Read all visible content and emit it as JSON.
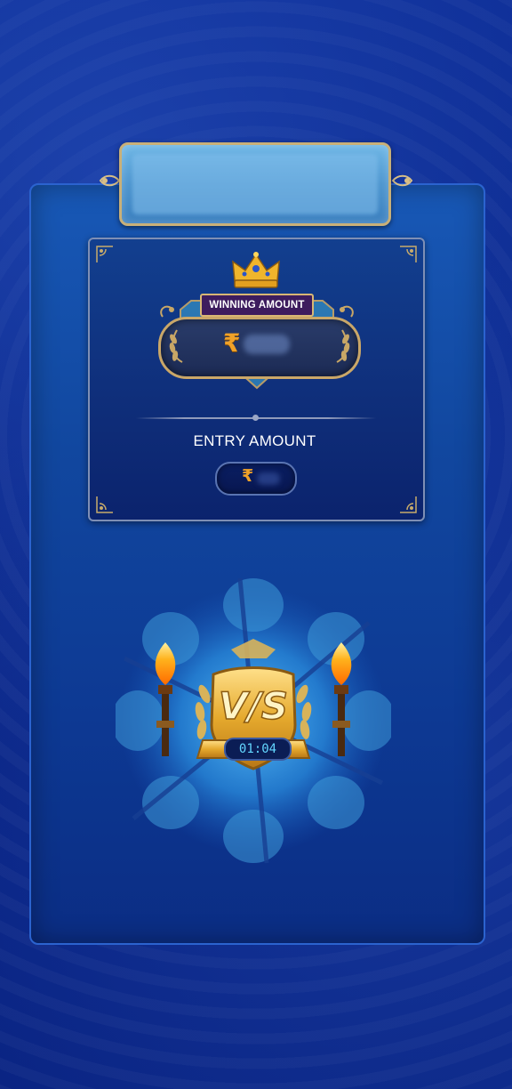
{
  "header": {
    "banner_text": ""
  },
  "prize_card": {
    "winning_label": "WINNING AMOUNT",
    "currency_symbol": "₹",
    "winning_value": "",
    "entry_label": "ENTRY AMOUNT",
    "entry_value": ""
  },
  "versus": {
    "emblem_text": "V/S",
    "timer": "01:04"
  },
  "icons": {
    "crown": "crown-icon",
    "torch": "torch-icon",
    "laurel": "laurel-icon",
    "shield": "shield-icon",
    "flourish": "flourish-icon"
  },
  "colors": {
    "background": "#0a2a8e",
    "panel": "#1858b6",
    "gold": "#c9a766",
    "rupee": "#f0a128",
    "timer_text": "#63d6ff",
    "win_tag_bg": "#3d1c5e"
  }
}
